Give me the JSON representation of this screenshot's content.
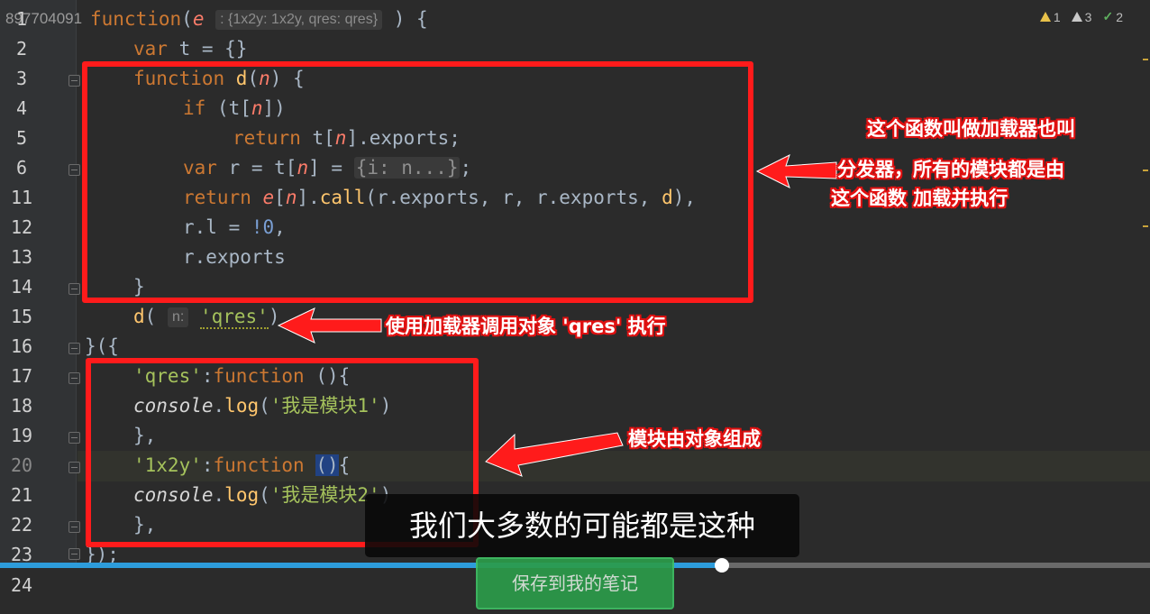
{
  "watermark": "897704091",
  "inspections": [
    {
      "icon": "warning-icon",
      "count": "1"
    },
    {
      "icon": "weak-warning-icon",
      "count": "3"
    },
    {
      "icon": "check-icon",
      "count": "2"
    }
  ],
  "line_numbers": [
    "1",
    "2",
    "3",
    "4",
    "5",
    "6",
    "11",
    "12",
    "13",
    "14",
    "15",
    "16",
    "17",
    "18",
    "19",
    "20",
    "21",
    "22",
    "23",
    "24"
  ],
  "code": {
    "l1": {
      "kw": "function",
      "open": "(",
      "param": "e",
      "hint": ": {1x2y: 1x2y, qres: qres}",
      "close": ") {"
    },
    "l2": {
      "kw": "var",
      "rest": " t = {}"
    },
    "l3": {
      "kw": "function",
      "fn": " d",
      "open": "(",
      "param": "n",
      "close": ") {"
    },
    "l4": {
      "kw": "if",
      "a": " (t[",
      "param": "n",
      "b": "])"
    },
    "l5": {
      "kw": "return",
      "a": " t[",
      "param": "n",
      "b": "].exports;"
    },
    "l6": {
      "kw": "var",
      "a": " r = t[",
      "param": "n",
      "b": "] = ",
      "chip": "{i: n...}",
      "c": ";"
    },
    "l11": {
      "kw": "return",
      "sp": " ",
      "param_e": "e",
      "a": "[",
      "param": "n",
      "b": "].",
      "fn": "call",
      "c": "(r.exports, r, r.exports, ",
      "fn2": "d",
      "d": "),"
    },
    "l12": {
      "a": "r.l = ",
      "num": "!0",
      "b": ","
    },
    "l13": {
      "a": "r.exports"
    },
    "l14": {
      "a": "}"
    },
    "l15": {
      "fn": "d",
      "a": "( ",
      "hint": "n:",
      "str": "'qres'",
      "b": ")"
    },
    "l16": {
      "a": "}({"
    },
    "l17": {
      "str": "'qres'",
      "a": ":",
      "kw": "function",
      "b": " (){"
    },
    "l18": {
      "glob": "console",
      "a": ".",
      "fn": "log",
      "b": "(",
      "str": "'我是模块1'",
      "c": ")"
    },
    "l19": {
      "a": "},"
    },
    "l20": {
      "str": "'1x2y'",
      "a": ":",
      "kw": "function",
      "sp": " ",
      "sel": "()",
      "b": "{"
    },
    "l21": {
      "glob": "console",
      "a": ".",
      "fn": "log",
      "b": "(",
      "str": "'我是模块2'",
      "c": ")"
    },
    "l22": {
      "a": "},"
    },
    "l23": {
      "a": "});"
    }
  },
  "annotations": {
    "loader_line1": "这个函数叫做加载器也叫",
    "loader_line2": "分发器，所有的模块都是由",
    "loader_line3": "这个函数 加载并执行",
    "call": "使用加载器调用对象 'qres' 执行",
    "modules": "模块由对象组成"
  },
  "subtitle": "我们大多数的可能都是这种",
  "video": {
    "progress": 0.628
  },
  "save_note_button": "保存到我的笔记"
}
